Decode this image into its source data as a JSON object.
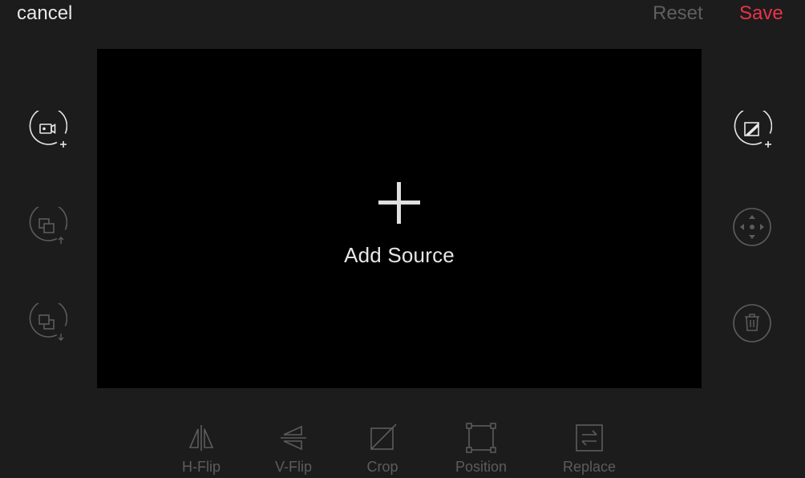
{
  "header": {
    "cancel_label": "cancel",
    "reset_label": "Reset",
    "save_label": "Save"
  },
  "preview": {
    "add_source_label": "Add Source"
  },
  "left_controls": [
    {
      "icon": "add-camera-icon",
      "enabled": true
    },
    {
      "icon": "layer-up-icon",
      "enabled": false
    },
    {
      "icon": "layer-down-icon",
      "enabled": false
    }
  ],
  "right_controls": [
    {
      "icon": "add-overlay-icon",
      "enabled": true
    },
    {
      "icon": "move-icon",
      "enabled": false
    },
    {
      "icon": "trash-icon",
      "enabled": false
    }
  ],
  "tools": [
    {
      "label": "H-Flip",
      "icon": "h-flip-icon"
    },
    {
      "label": "V-Flip",
      "icon": "v-flip-icon"
    },
    {
      "label": "Crop",
      "icon": "crop-icon"
    },
    {
      "label": "Position",
      "icon": "position-icon"
    },
    {
      "label": "Replace",
      "icon": "replace-icon"
    }
  ],
  "colors": {
    "background": "#1c1c1c",
    "preview": "#000000",
    "accent": "#e8334a",
    "enabled": "#e8e8e8",
    "disabled": "#5c5c5c"
  }
}
